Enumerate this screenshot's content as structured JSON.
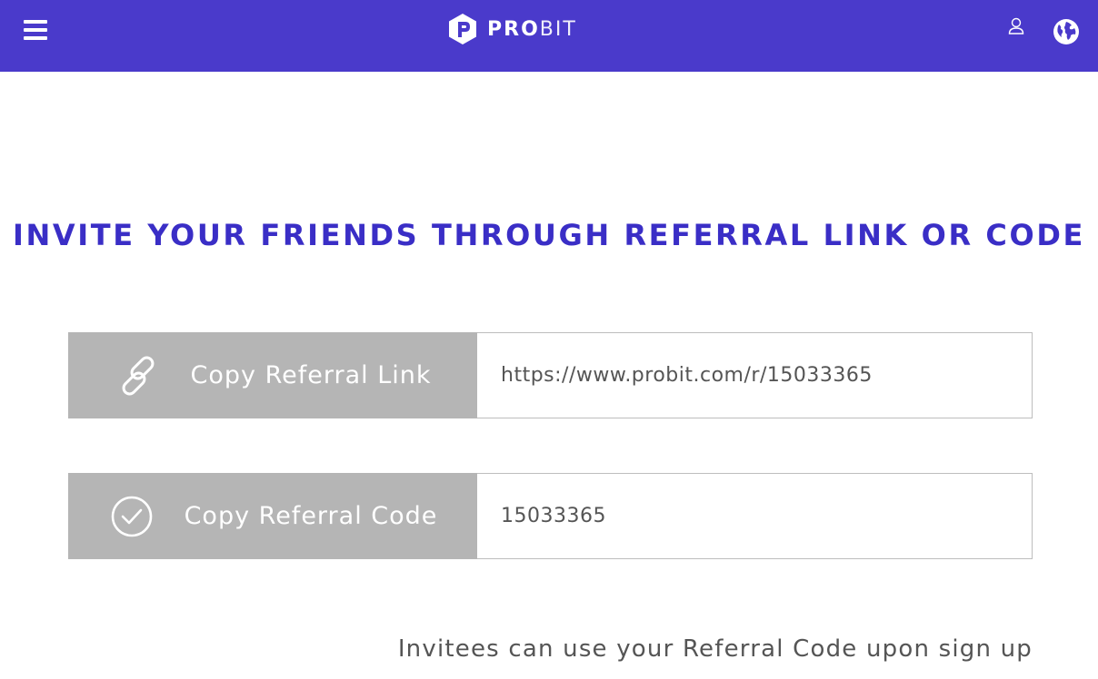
{
  "header": {
    "logo_bold": "PRO",
    "logo_light": "BIT",
    "icons": {
      "menu": "hamburger-menu-icon",
      "user": "user-icon",
      "language": "globe-icon"
    },
    "colors": {
      "bar": "#4a3acb",
      "text": "#ffffff"
    }
  },
  "main": {
    "title": "INVITE YOUR FRIENDS THROUGH REFERRAL LINK OR CODE",
    "title_color": "#3a2ec6",
    "link_row": {
      "button_label": "Copy Referral Link",
      "icon": "link-icon",
      "value": "https://www.probit.com/r/15033365"
    },
    "code_row": {
      "button_label": "Copy Referral Code",
      "icon": "check-circle-icon",
      "value": "15033365"
    },
    "note": "Invitees can use your Referral Code upon sign up",
    "button_color": "#b5b5b5"
  }
}
